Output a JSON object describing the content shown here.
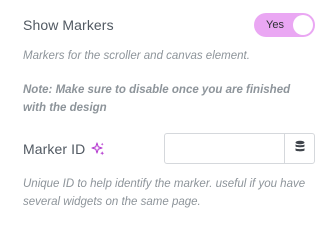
{
  "show_markers": {
    "label": "Show Markers",
    "toggle_label": "Yes",
    "toggle_on": true,
    "description": "Markers for the scroller and canvas element.",
    "note": "Note: Make sure to disable once you are finished with the design"
  },
  "marker_id": {
    "label": "Marker ID",
    "label_icon": "sparkle-icon",
    "input_value": "",
    "input_placeholder": "",
    "dynamic_icon": "database-icon",
    "description": "Unique ID to help identify the marker. useful if you have several widgets on the same page."
  },
  "colors": {
    "toggle_bg": "#eaa7f3",
    "sparkle": "#b63fd1",
    "label": "#515962",
    "description": "#8d949a"
  }
}
